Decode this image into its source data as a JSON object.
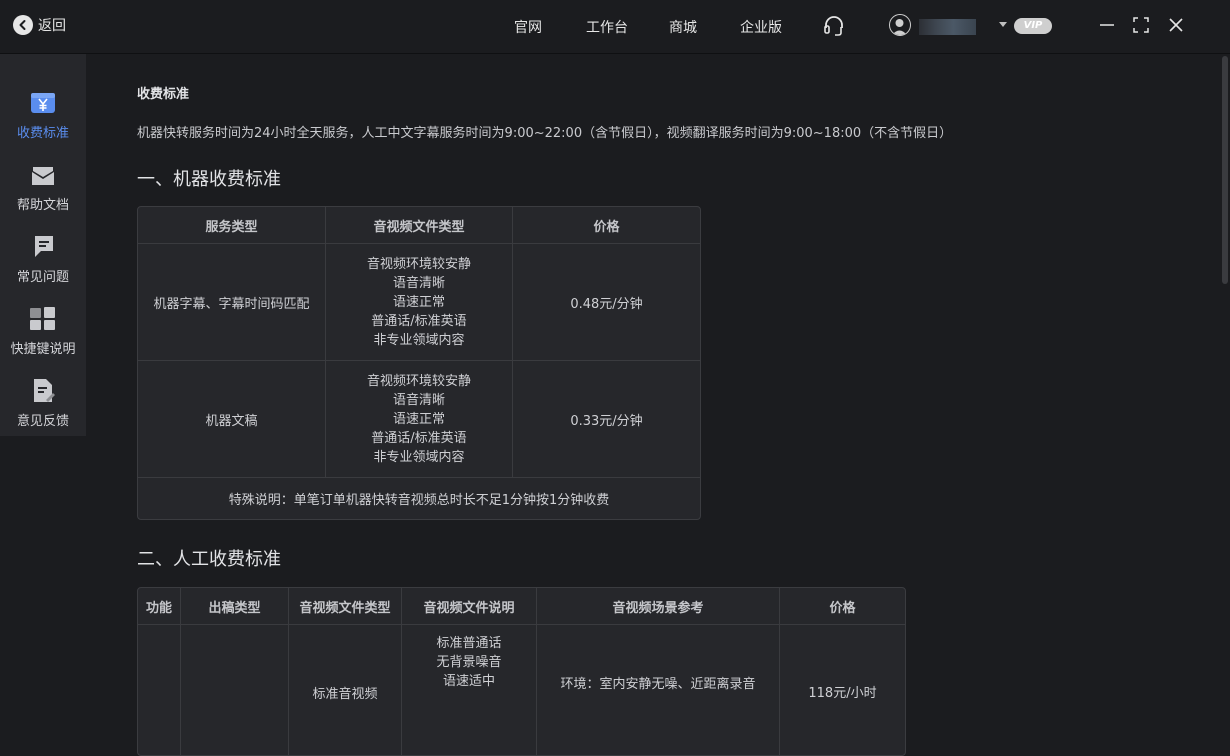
{
  "topbar": {
    "back_label": "返回",
    "nav": [
      "官网",
      "工作台",
      "商城",
      "企业版"
    ],
    "vip_badge": "VIP"
  },
  "sidebar": {
    "items": [
      {
        "label": "收费标准",
        "icon": "yen-icon",
        "active": true
      },
      {
        "label": "帮助文档",
        "icon": "envelope-icon",
        "active": false
      },
      {
        "label": "常见问题",
        "icon": "chat-icon",
        "active": false
      },
      {
        "label": "快捷键说明",
        "icon": "shortcut-grid-icon",
        "active": false
      },
      {
        "label": "意见反馈",
        "icon": "feedback-doc-icon",
        "active": false
      }
    ]
  },
  "page": {
    "title": "收费标准",
    "description": "机器快转服务时间为24小时全天服务，人工中文字幕服务时间为9:00~22:00（含节假日），视频翻译服务时间为9:00~18:00（不含节假日）"
  },
  "machine": {
    "section_title": "一、机器收费标准",
    "headers": [
      "服务类型",
      "音视频文件类型",
      "价格"
    ],
    "rows": [
      {
        "service": "机器字幕、字幕时间码匹配",
        "file_type": [
          "音视频环境较安静",
          "语音清晰",
          "语速正常",
          "普通话/标准英语",
          "非专业领域内容"
        ],
        "price": "0.48元/分钟"
      },
      {
        "service": "机器文稿",
        "file_type": [
          "音视频环境较安静",
          "语音清晰",
          "语速正常",
          "普通话/标准英语",
          "非专业领域内容"
        ],
        "price": "0.33元/分钟"
      }
    ],
    "note": "特殊说明：单笔订单机器快转音视频总时长不足1分钟按1分钟收费"
  },
  "manual": {
    "section_title": "二、人工收费标准",
    "headers": [
      "功能",
      "出稿类型",
      "音视频文件类型",
      "音视频文件说明",
      "音视频场景参考",
      "价格"
    ],
    "row": {
      "file_type": "标准音视频",
      "file_desc": [
        "标准普通话",
        "无背景噪音",
        "语速适中"
      ],
      "scene": "环境：室内安静无噪、近距离录音",
      "price": "118元/小时"
    }
  },
  "colors": {
    "background": "#1b1c1f",
    "sidebar": "#26272b",
    "accent": "#5a8dee",
    "table_bg": "#26272b"
  }
}
